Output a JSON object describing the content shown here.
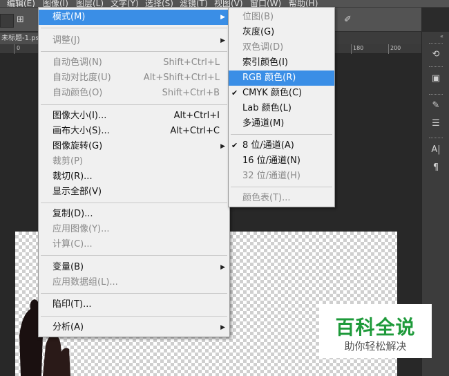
{
  "menubar": {
    "items": [
      "编辑(E)",
      "图像(I)",
      "图层(L)",
      "文字(Y)",
      "选择(S)",
      "滤镜(T)",
      "视图(V)",
      "窗口(W)",
      "帮助(H)"
    ]
  },
  "doc_tab": {
    "title": "未标题-1.ps"
  },
  "ruler": {
    "labels": [
      "0",
      "180",
      "200"
    ]
  },
  "image_menu": {
    "items": [
      {
        "label": "模式(M)",
        "submenu": true,
        "highlighted": true
      },
      {
        "label": "调整(J)",
        "submenu": true,
        "disabled": true
      },
      {
        "label": "自动色调(N)",
        "shortcut": "Shift+Ctrl+L",
        "disabled": true
      },
      {
        "label": "自动对比度(U)",
        "shortcut": "Alt+Shift+Ctrl+L",
        "disabled": true
      },
      {
        "label": "自动颜色(O)",
        "shortcut": "Shift+Ctrl+B",
        "disabled": true
      },
      {
        "label": "图像大小(I)...",
        "shortcut": "Alt+Ctrl+I"
      },
      {
        "label": "画布大小(S)...",
        "shortcut": "Alt+Ctrl+C"
      },
      {
        "label": "图像旋转(G)",
        "submenu": true
      },
      {
        "label": "裁剪(P)",
        "disabled": true
      },
      {
        "label": "裁切(R)..."
      },
      {
        "label": "显示全部(V)"
      },
      {
        "label": "复制(D)..."
      },
      {
        "label": "应用图像(Y)...",
        "disabled": true
      },
      {
        "label": "计算(C)...",
        "disabled": true
      },
      {
        "label": "变量(B)",
        "submenu": true
      },
      {
        "label": "应用数据组(L)...",
        "disabled": true
      },
      {
        "label": "陷印(T)..."
      },
      {
        "label": "分析(A)",
        "submenu": true
      }
    ]
  },
  "mode_menu": {
    "items": [
      {
        "label": "位图(B)",
        "disabled": true
      },
      {
        "label": "灰度(G)"
      },
      {
        "label": "双色调(D)",
        "disabled": true
      },
      {
        "label": "索引颜色(I)"
      },
      {
        "label": "RGB 颜色(R)",
        "highlighted": true
      },
      {
        "label": "CMYK 颜色(C)",
        "checked": true
      },
      {
        "label": "Lab 颜色(L)"
      },
      {
        "label": "多通道(M)"
      },
      {
        "label": "8 位/通道(A)",
        "checked": true
      },
      {
        "label": "16 位/通道(N)"
      },
      {
        "label": "32 位/通道(H)",
        "disabled": true
      },
      {
        "label": "颜色表(T)...",
        "disabled": true
      }
    ]
  },
  "watermark": {
    "title": "百科全说",
    "subtitle": "助你轻松解决"
  },
  "colors": {
    "highlight": "#3a8ee6",
    "menu_bg": "#f0f0f0",
    "logo_green": "#1e9a3a"
  }
}
